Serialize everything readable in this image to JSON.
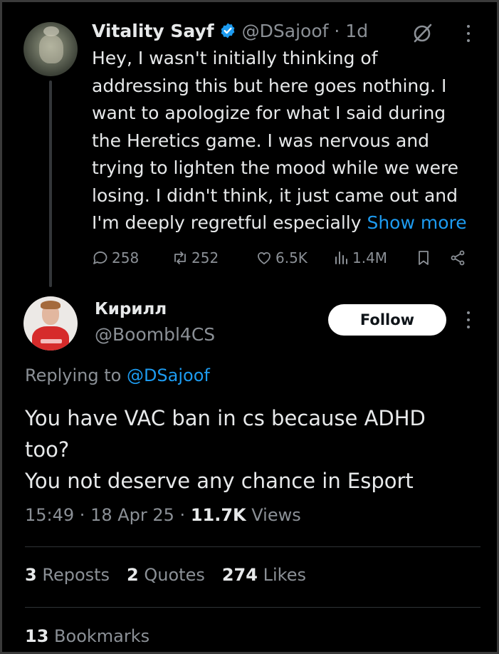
{
  "parent_tweet": {
    "display_name": "Vitality Sayf",
    "handle": "@DSajoof",
    "time_sep": " · ",
    "age": "1d",
    "text_lines": [
      "Hey, I wasn't initially thinking of",
      "addressing this but here goes nothing. I",
      "want to apologize  for what I said during",
      "the Heretics game. I was nervous and",
      "trying to lighten the mood while we were",
      "losing. I didn't think, it just came out and",
      "I'm deeply regretful especially "
    ],
    "show_more": "Show more",
    "actions": {
      "replies": "258",
      "reposts": "252",
      "likes": "6.5K",
      "views": "1.4M"
    }
  },
  "reply_tweet": {
    "display_name": "Кирилл",
    "handle": "@Boombl4CS",
    "follow_label": "Follow",
    "replying_prefix": "Replying to ",
    "replying_to": "@DSajoof",
    "text_lines": [
      "You have VAC ban in cs because ADHD",
      "too?",
      "You not deserve any chance in Esport"
    ],
    "time": "15:49",
    "date": "18 Apr 25",
    "views_count": "11.7K",
    "views_label": "Views",
    "sep": " · ",
    "stats": {
      "reposts_count": "3",
      "reposts_label": "Reposts",
      "quotes_count": "2",
      "quotes_label": "Quotes",
      "likes_count": "274",
      "likes_label": "Likes",
      "bookmarks_count": "13",
      "bookmarks_label": "Bookmarks"
    }
  },
  "colors": {
    "background": "#000000",
    "text_primary": "#e7e9ea",
    "text_secondary": "#8b9096",
    "accent": "#1d9bf0",
    "divider": "#2f3336"
  },
  "icons": [
    "verified-badge-icon",
    "grok-icon",
    "more-icon",
    "reply-icon",
    "repost-icon",
    "like-icon",
    "views-icon",
    "bookmark-icon",
    "share-icon"
  ]
}
